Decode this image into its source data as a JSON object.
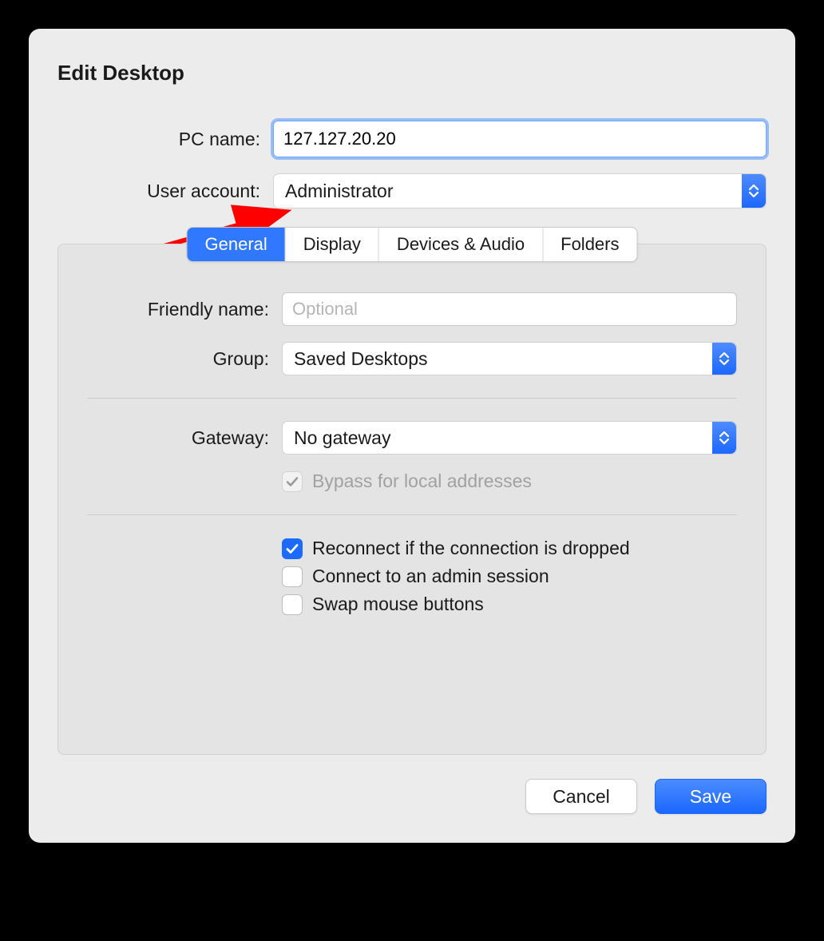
{
  "title": "Edit Desktop",
  "top": {
    "pc_name_label": "PC name:",
    "pc_name_value": "127.127.20.20",
    "user_account_label": "User account:",
    "user_account_value": "Administrator"
  },
  "tabs": [
    "General",
    "Display",
    "Devices & Audio",
    "Folders"
  ],
  "general": {
    "friendly_name_label": "Friendly name:",
    "friendly_name_placeholder": "Optional",
    "friendly_name_value": "",
    "group_label": "Group:",
    "group_value": "Saved Desktops",
    "gateway_label": "Gateway:",
    "gateway_value": "No gateway",
    "bypass_label": "Bypass for local addresses",
    "bypass_checked": true,
    "bypass_enabled": false,
    "options": {
      "reconnect_label": "Reconnect if the connection is dropped",
      "reconnect_checked": true,
      "admin_label": "Connect to an admin session",
      "admin_checked": false,
      "swap_label": "Swap mouse buttons",
      "swap_checked": false
    }
  },
  "footer": {
    "cancel": "Cancel",
    "save": "Save"
  },
  "colors": {
    "accent": "#1d6aff",
    "annotation": "#ff0000"
  }
}
